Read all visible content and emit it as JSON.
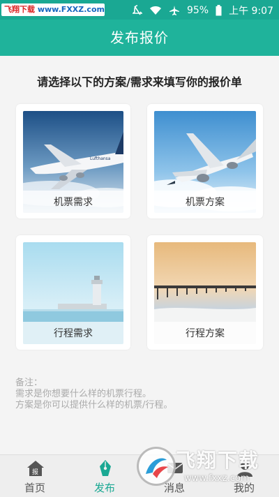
{
  "status_bar": {
    "watermark_brand": "飞翔下载",
    "watermark_url": "www.FXXZ.com",
    "battery": "95%",
    "time": "上午 9:07"
  },
  "header": {
    "title": "发布报价"
  },
  "subtitle": "请选择以下的方案/需求来填写你的报价单",
  "cards": [
    {
      "label": "机票需求",
      "image": "airplane-lufthansa"
    },
    {
      "label": "机票方案",
      "image": "airplane-clouds"
    },
    {
      "label": "行程需求",
      "image": "lighthouse-sea"
    },
    {
      "label": "行程方案",
      "image": "pier-sunset"
    }
  ],
  "note": {
    "title": "备注：",
    "line1": "需求是你想要什么样的机票行程。",
    "line2": "方案是你可以提供什么样的机票/行程。"
  },
  "nav": {
    "items": [
      {
        "label": "首页",
        "icon": "home-icon",
        "active": false
      },
      {
        "label": "发布",
        "icon": "pen-icon",
        "active": true
      },
      {
        "label": "消息",
        "icon": "message-icon",
        "active": false
      },
      {
        "label": "我的",
        "icon": "user-icon",
        "active": false
      }
    ]
  },
  "bottom_watermark": {
    "name": "飞翔下载",
    "url": "www.fxxz.com"
  },
  "colors": {
    "accent": "#1fb39b",
    "status_bar": "#1aa893"
  }
}
